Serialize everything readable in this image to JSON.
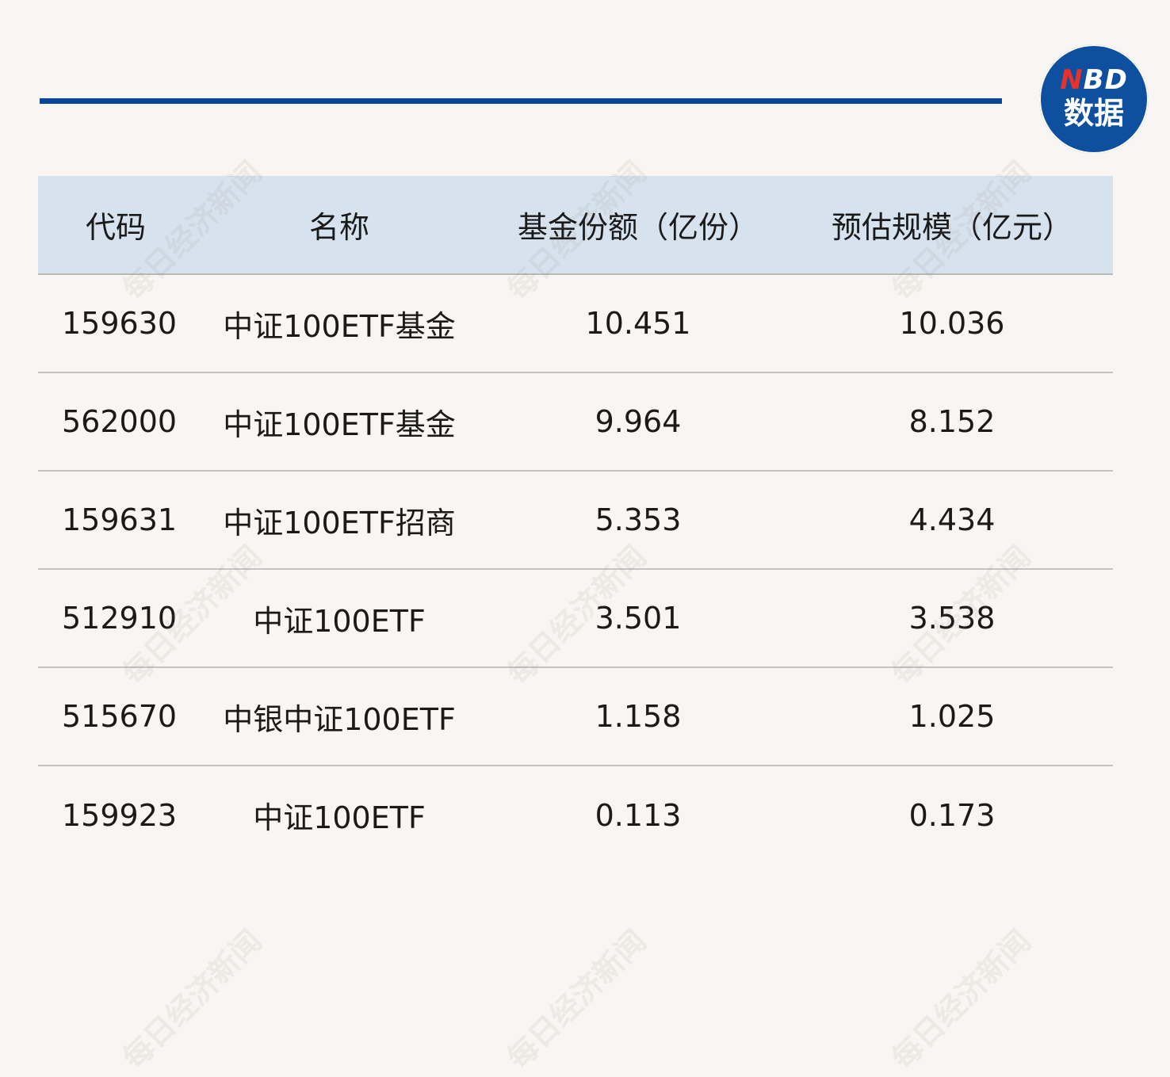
{
  "logo": {
    "letter_n": "N",
    "letters_bd": "BD",
    "label": "数据"
  },
  "watermark_text": "每日经济新闻",
  "table": {
    "headers": [
      "代码",
      "名称",
      "基金份额（亿份）",
      "预估规模（亿元）"
    ],
    "rows": [
      [
        "159630",
        "中证100ETF基金",
        "10.451",
        "10.036"
      ],
      [
        "562000",
        "中证100ETF基金",
        "9.964",
        "8.152"
      ],
      [
        "159631",
        "中证100ETF招商",
        "5.353",
        "4.434"
      ],
      [
        "512910",
        "中证100ETF",
        "3.501",
        "3.538"
      ],
      [
        "515670",
        "中银中证100ETF",
        "1.158",
        "1.025"
      ],
      [
        "159923",
        "中证100ETF",
        "0.113",
        "0.173"
      ]
    ]
  },
  "colors": {
    "background": "#f8f5f2",
    "accent_rule": "#0a4697",
    "header_bg": "#d6e3ef",
    "logo_bg": "#0f4fa0",
    "logo_red": "#e5322b"
  }
}
